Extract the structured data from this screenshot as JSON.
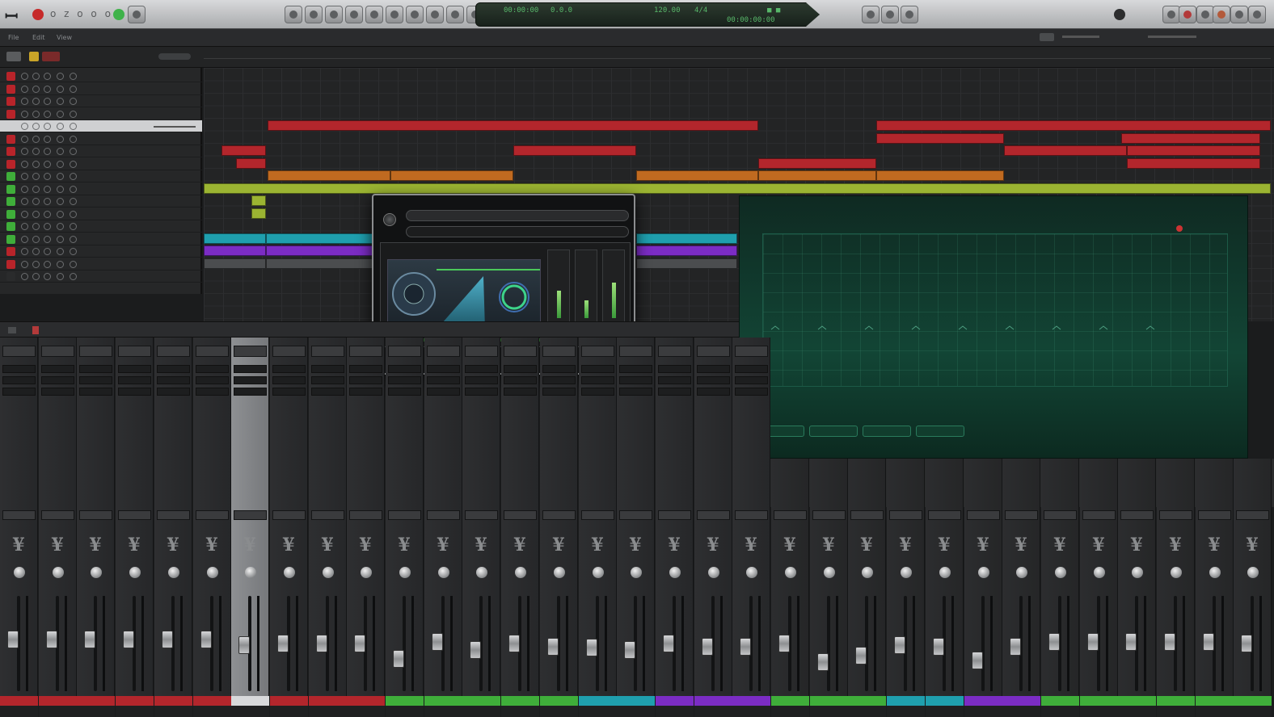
{
  "toolbar": {
    "logo": "ꟷ",
    "letters": "o z o o o",
    "lcd": [
      "00:00:00",
      "0.0.0",
      "120.00",
      "4/4",
      "00:00:00:00",
      "■ ■"
    ],
    "tools_count": 10
  },
  "row2": {
    "menu": [
      "File",
      "Edit",
      "View"
    ]
  },
  "tracks": [
    {
      "name": "",
      "color": "#b8242a"
    },
    {
      "name": "",
      "color": "#b8242a"
    },
    {
      "name": "",
      "color": "#b8242a"
    },
    {
      "name": "",
      "color": "#b8242a"
    },
    {
      "name": "",
      "color": "#cfd0d2",
      "selected": true
    },
    {
      "name": "",
      "color": "#b8242a"
    },
    {
      "name": "",
      "color": "#b8242a"
    },
    {
      "name": "",
      "color": "#b8242a"
    },
    {
      "name": "",
      "color": "#3fae3a"
    },
    {
      "name": "",
      "color": "#3fae3a"
    },
    {
      "name": "",
      "color": "#3fae3a"
    },
    {
      "name": "",
      "color": "#3fae3a"
    },
    {
      "name": "",
      "color": "#3fae3a"
    },
    {
      "name": "",
      "color": "#3fae3a"
    },
    {
      "name": "",
      "color": "#b8242a"
    },
    {
      "name": "",
      "color": "#b8242a"
    },
    {
      "name": "",
      "color": "#2a2b2c"
    }
  ],
  "clips": [
    {
      "row": 4,
      "start": 0.06,
      "end": 0.52,
      "color": "red",
      "label": ""
    },
    {
      "row": 4,
      "start": 0.63,
      "end": 1.0,
      "color": "red",
      "label": ""
    },
    {
      "row": 5,
      "start": 0.63,
      "end": 0.75,
      "color": "red",
      "label": ""
    },
    {
      "row": 5,
      "start": 0.86,
      "end": 0.99,
      "color": "red",
      "label": ""
    },
    {
      "row": 6,
      "start": 0.017,
      "end": 0.058,
      "color": "red",
      "label": ""
    },
    {
      "row": 6,
      "start": 0.29,
      "end": 0.405,
      "color": "red",
      "label": ""
    },
    {
      "row": 6,
      "start": 0.75,
      "end": 0.865,
      "color": "red",
      "label": ""
    },
    {
      "row": 6,
      "start": 0.865,
      "end": 0.99,
      "color": "red",
      "label": ""
    },
    {
      "row": 7,
      "start": 0.03,
      "end": 0.058,
      "color": "red",
      "label": ""
    },
    {
      "row": 7,
      "start": 0.52,
      "end": 0.63,
      "color": "red",
      "label": ""
    },
    {
      "row": 7,
      "start": 0.865,
      "end": 0.99,
      "color": "red",
      "label": ""
    },
    {
      "row": 8,
      "start": 0.06,
      "end": 0.175,
      "color": "orange",
      "label": ""
    },
    {
      "row": 8,
      "start": 0.175,
      "end": 0.29,
      "color": "orange",
      "label": ""
    },
    {
      "row": 8,
      "start": 0.405,
      "end": 0.52,
      "color": "orange",
      "label": ""
    },
    {
      "row": 8,
      "start": 0.52,
      "end": 0.63,
      "color": "orange",
      "label": ""
    },
    {
      "row": 8,
      "start": 0.63,
      "end": 0.75,
      "color": "orange",
      "label": ""
    },
    {
      "row": 9,
      "start": 0.0,
      "end": 1.0,
      "color": "lime",
      "label": ""
    },
    {
      "row": 10,
      "start": 0.045,
      "end": 0.058,
      "color": "lime",
      "label": ""
    },
    {
      "row": 11,
      "start": 0.045,
      "end": 0.058,
      "color": "lime",
      "label": ""
    },
    {
      "row": 13,
      "start": 0.0,
      "end": 0.058,
      "color": "cyan",
      "label": ""
    },
    {
      "row": 13,
      "start": 0.058,
      "end": 0.16,
      "color": "cyan",
      "label": ""
    },
    {
      "row": 13,
      "start": 0.405,
      "end": 0.5,
      "color": "cyan",
      "label": ""
    },
    {
      "row": 14,
      "start": 0.0,
      "end": 0.058,
      "color": "purple",
      "label": ""
    },
    {
      "row": 14,
      "start": 0.058,
      "end": 0.16,
      "color": "purple",
      "label": ""
    },
    {
      "row": 14,
      "start": 0.405,
      "end": 0.5,
      "color": "purple",
      "label": ""
    },
    {
      "row": 15,
      "start": 0.0,
      "end": 0.058,
      "color": "gray",
      "label": ""
    },
    {
      "row": 15,
      "start": 0.058,
      "end": 0.16,
      "color": "gray",
      "label": ""
    },
    {
      "row": 15,
      "start": 0.405,
      "end": 0.5,
      "color": "gray",
      "label": ""
    }
  ],
  "plugin": {
    "title": "",
    "preset": "",
    "footer": "",
    "meters": [
      0.42,
      0.28,
      0.55
    ]
  },
  "analyzer": {
    "title": "",
    "subtitle": "",
    "freq_labels": [
      "",
      "",
      "",
      "",
      "",
      "",
      "",
      "",
      ""
    ],
    "buttons": [
      "",
      "",
      "",
      ""
    ],
    "footer": ""
  },
  "mixer": {
    "header_label": "",
    "strips": [
      {
        "name": "",
        "color": "#b3262c",
        "fader": 0.55
      },
      {
        "name": "",
        "color": "#b3262c",
        "fader": 0.55
      },
      {
        "name": "",
        "color": "#b3262c",
        "fader": 0.55
      },
      {
        "name": "",
        "color": "#b3262c",
        "fader": 0.55
      },
      {
        "name": "",
        "color": "#b3262c",
        "fader": 0.55
      },
      {
        "name": "",
        "color": "#b3262c",
        "fader": 0.55
      },
      {
        "name": "",
        "color": "#d8d9db",
        "fader": 0.48,
        "highlight": true
      },
      {
        "name": "",
        "color": "#b3262c",
        "fader": 0.5
      },
      {
        "name": "",
        "color": "#b3262c",
        "fader": 0.5
      },
      {
        "name": "",
        "color": "#b3262c",
        "fader": 0.5
      },
      {
        "name": "",
        "color": "#3fae3a",
        "fader": 0.3
      },
      {
        "name": "",
        "color": "#3fae3a",
        "fader": 0.52
      },
      {
        "name": "",
        "color": "#3fae3a",
        "fader": 0.42
      },
      {
        "name": "",
        "color": "#3fae3a",
        "fader": 0.5
      },
      {
        "name": "",
        "color": "#3fae3a",
        "fader": 0.46
      },
      {
        "name": "",
        "color": "#1f9fae",
        "fader": 0.45
      },
      {
        "name": "",
        "color": "#1f9fae",
        "fader": 0.42
      },
      {
        "name": "",
        "color": "#7b2cc4",
        "fader": 0.5
      },
      {
        "name": "",
        "color": "#7b2cc4",
        "fader": 0.46
      },
      {
        "name": "",
        "color": "#7b2cc4",
        "fader": 0.46
      },
      {
        "name": "",
        "color": "#3fae3a",
        "fader": 0.5
      },
      {
        "name": "",
        "color": "#3fae3a",
        "fader": 0.26
      },
      {
        "name": "",
        "color": "#3fae3a",
        "fader": 0.34
      },
      {
        "name": "",
        "color": "#1f9fae",
        "fader": 0.48
      },
      {
        "name": "",
        "color": "#1f9fae",
        "fader": 0.46
      },
      {
        "name": "",
        "color": "#7b2cc4",
        "fader": 0.28
      },
      {
        "name": "",
        "color": "#7b2cc4",
        "fader": 0.46
      },
      {
        "name": "",
        "color": "#3fae3a",
        "fader": 0.52
      },
      {
        "name": "",
        "color": "#3fae3a",
        "fader": 0.52
      },
      {
        "name": "",
        "color": "#3fae3a",
        "fader": 0.52
      },
      {
        "name": "",
        "color": "#3fae3a",
        "fader": 0.52
      },
      {
        "name": "",
        "color": "#3fae3a",
        "fader": 0.52
      },
      {
        "name": "",
        "color": "#3fae3a",
        "fader": 0.5
      }
    ]
  }
}
